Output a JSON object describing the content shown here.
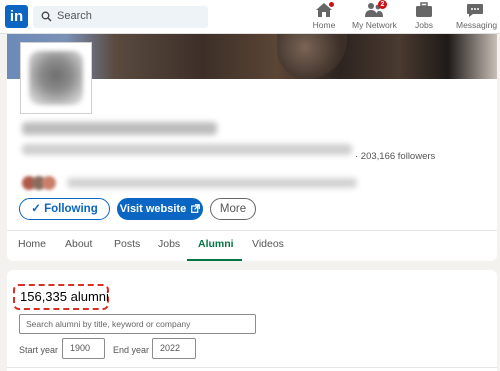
{
  "nav": {
    "logo_text": "in",
    "search_placeholder": "Search",
    "items": [
      {
        "label": "Home",
        "icon": "home-icon"
      },
      {
        "label": "My Network",
        "icon": "network-icon",
        "badge": "2"
      },
      {
        "label": "Jobs",
        "icon": "briefcase-icon"
      },
      {
        "label": "Messaging",
        "icon": "messaging-icon"
      }
    ]
  },
  "profile": {
    "followers": "· 203,166 followers",
    "actions": {
      "follow_label": "✓ Following",
      "visit_label": "Visit website",
      "more_label": "More"
    }
  },
  "tabs": [
    {
      "label": "Home"
    },
    {
      "label": "About"
    },
    {
      "label": "Posts"
    },
    {
      "label": "Jobs"
    },
    {
      "label": "Alumni",
      "active": true
    },
    {
      "label": "Videos"
    }
  ],
  "alumni": {
    "count": "156,335 alumni",
    "search_placeholder": "Search alumni by title, keyword or company",
    "start_label": "Start year",
    "start_value": "1900",
    "end_label": "End year",
    "end_value": "2022"
  },
  "colors": {
    "brand": "#0a66c2",
    "active_tab": "#057642",
    "highlight": "#d93025"
  }
}
